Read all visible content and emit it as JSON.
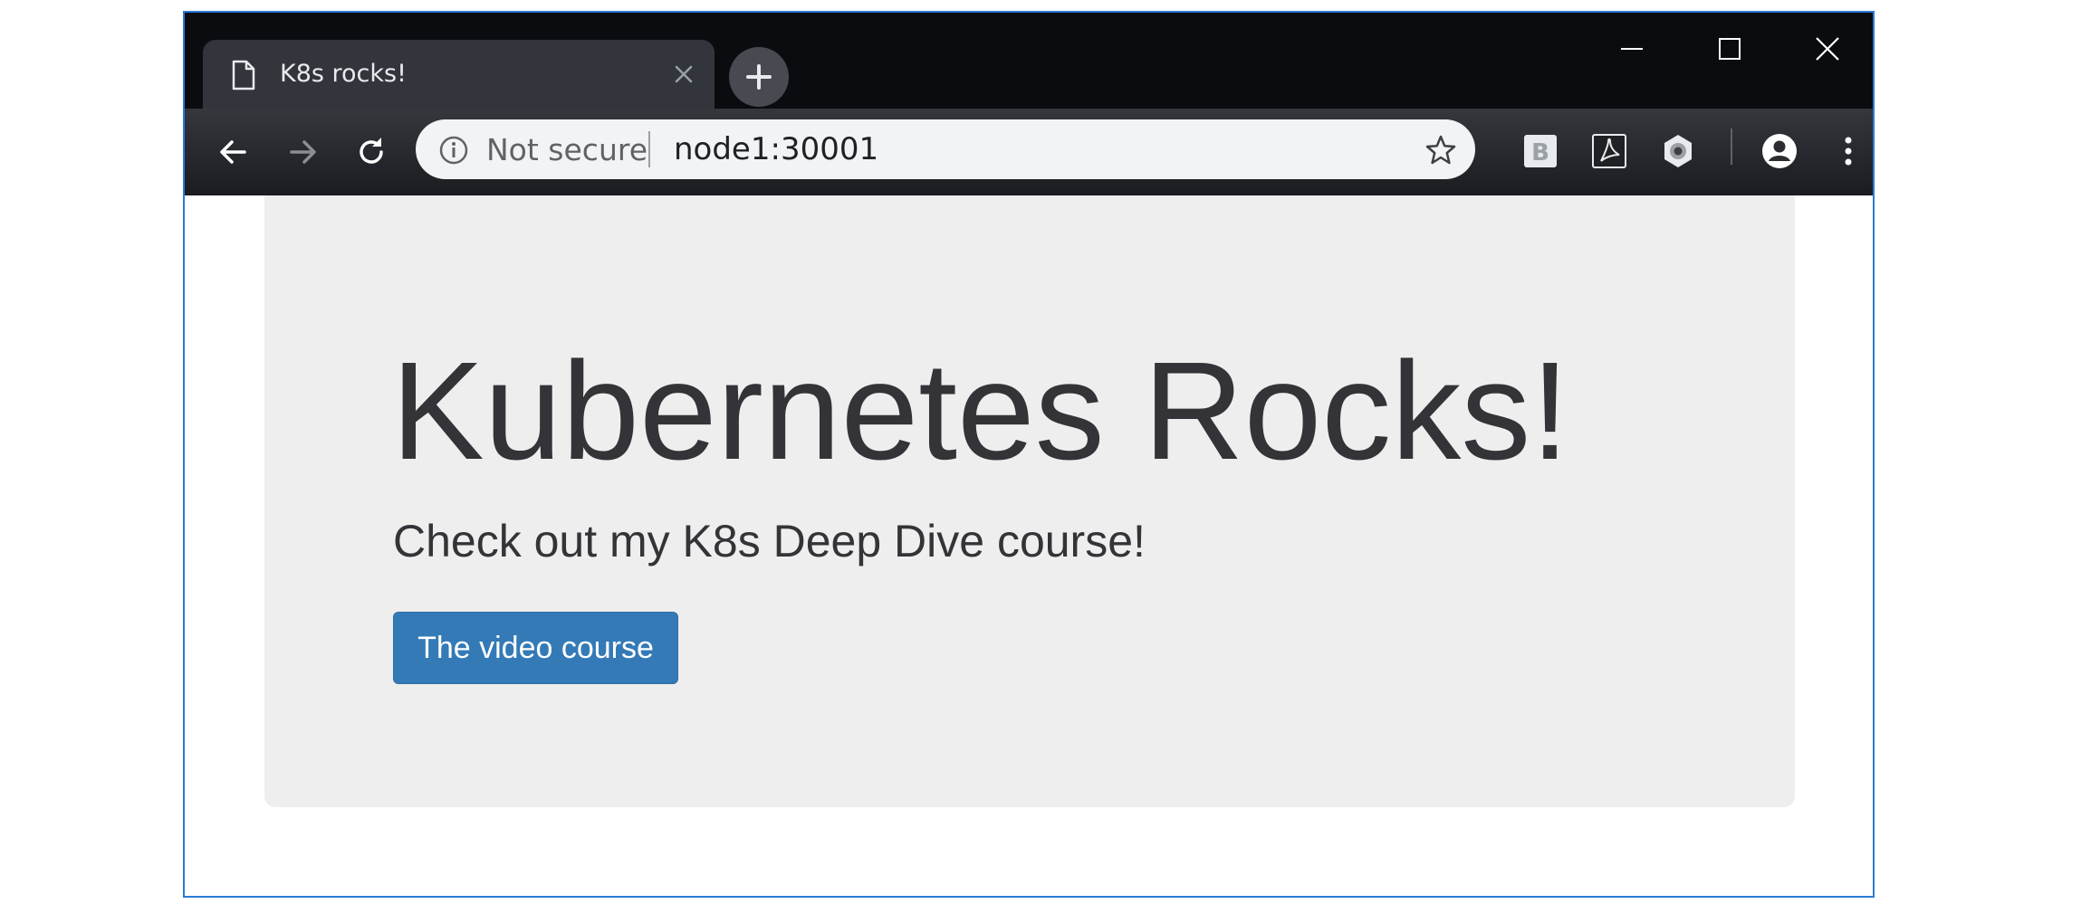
{
  "tab": {
    "title": "K8s rocks!",
    "icon": "document-icon"
  },
  "toolbar": {
    "security_label": "Not secure",
    "url": "node1:30001",
    "extensions": [
      "bootstrap-extension-icon",
      "acrobat-extension-icon",
      "gear-extension-icon"
    ]
  },
  "page": {
    "heading": "Kubernetes Rocks!",
    "lead": "Check out my K8s Deep Dive course!",
    "button_label": "The video course"
  },
  "colors": {
    "window_border": "#2b7ad6",
    "titlebar": "#0a0c10",
    "jumbotron_bg": "#eeeeee",
    "button_primary": "#337ab7",
    "heading_text": "#333338"
  }
}
